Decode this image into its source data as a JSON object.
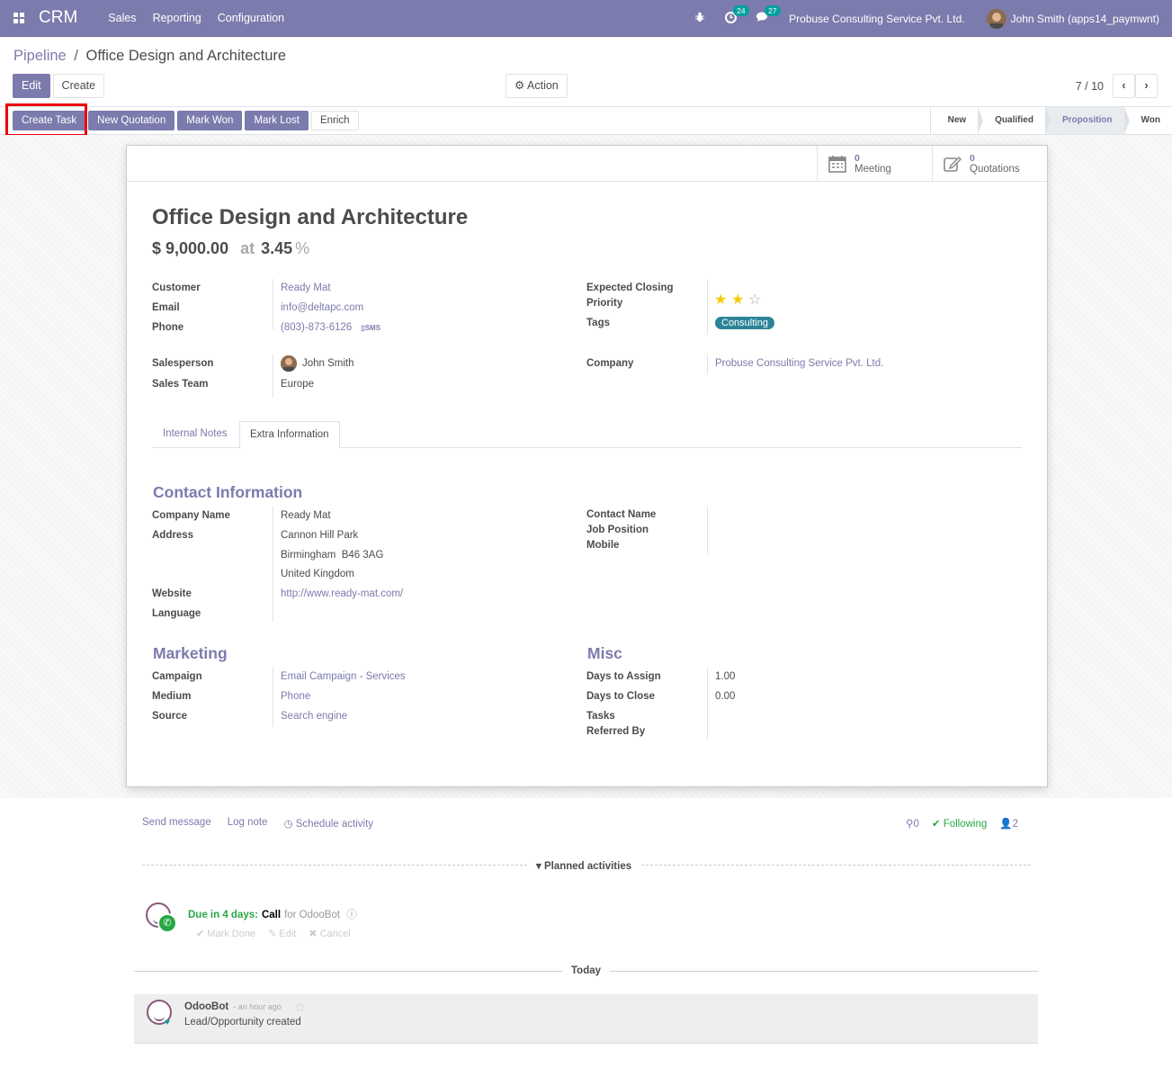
{
  "navbar": {
    "brand": "CRM",
    "menu": [
      "Sales",
      "Reporting",
      "Configuration"
    ],
    "activity_count": "24",
    "message_count": "27",
    "company": "Probuse Consulting Service Pvt. Ltd.",
    "user": "John Smith (apps14_paymwnt)"
  },
  "breadcrumb": {
    "parent": "Pipeline",
    "separator": "/",
    "current": "Office Design and Architecture"
  },
  "control": {
    "edit_label": "Edit",
    "create_label": "Create",
    "action_label": "Action",
    "pager_value": "7 / 10"
  },
  "statusbar": {
    "buttons": [
      "Create Task",
      "New Quotation",
      "Mark Won",
      "Mark Lost",
      "Enrich"
    ],
    "stages": [
      "New",
      "Qualified",
      "Proposition",
      "Won"
    ],
    "active_stage": "Proposition"
  },
  "smart_buttons": {
    "meeting_count": "0",
    "meeting_label": "Meeting",
    "quotation_count": "0",
    "quotation_label": "Quotations"
  },
  "record": {
    "title": "Office Design and Architecture",
    "revenue": "$ 9,000.00",
    "at": "at",
    "probability": "3.45",
    "pct_sign": "%"
  },
  "fields": {
    "customer_label": "Customer",
    "customer": "Ready Mat",
    "email_label": "Email",
    "email": "info@deltapc.com",
    "phone_label": "Phone",
    "phone": "(803)-873-6126",
    "sms": "SMS",
    "salesperson_label": "Salesperson",
    "salesperson": "John Smith",
    "team_label": "Sales Team",
    "team": "Europe",
    "closing_label": "Expected Closing",
    "priority_label": "Priority",
    "priority_stars": 2,
    "tags_label": "Tags",
    "tag": "Consulting",
    "company_label": "Company",
    "company": "Probuse Consulting Service Pvt. Ltd."
  },
  "tabs": [
    "Internal Notes",
    "Extra Information"
  ],
  "contact": {
    "title": "Contact Information",
    "company_name_label": "Company Name",
    "company_name": "Ready Mat",
    "address_label": "Address",
    "address_1": "Cannon Hill Park",
    "address_2": "Birmingham  B46 3AG",
    "address_3": "United Kingdom",
    "website_label": "Website",
    "website": "http://www.ready-mat.com/",
    "language_label": "Language",
    "contact_name_label": "Contact Name",
    "job_label": "Job Position",
    "mobile_label": "Mobile"
  },
  "marketing": {
    "title": "Marketing",
    "campaign_label": "Campaign",
    "campaign": "Email Campaign - Services",
    "medium_label": "Medium",
    "medium": "Phone",
    "source_label": "Source",
    "source": "Search engine"
  },
  "misc": {
    "title": "Misc",
    "assign_label": "Days to Assign",
    "assign": "1.00",
    "close_label": "Days to Close",
    "close": "0.00",
    "tasks_label": "Tasks",
    "referred_label": "Referred By"
  },
  "chatter": {
    "send_message": "Send message",
    "log_note": "Log note",
    "schedule": "Schedule activity",
    "attachments": "0",
    "following": "Following",
    "followers": "2",
    "planned": "Planned activities",
    "due": "Due in 4 days:",
    "activity_type": "Call",
    "activity_for": "for OdooBot",
    "mark_done": "Mark Done",
    "edit": "Edit",
    "cancel": "Cancel",
    "today": "Today",
    "author": "OdooBot",
    "time": "- an hour ago",
    "body": "Lead/Opportunity created"
  },
  "colors": {
    "brand": "#7c7bad",
    "tag": "#2c8397",
    "success": "#28a745",
    "highlight": "#e00000"
  }
}
